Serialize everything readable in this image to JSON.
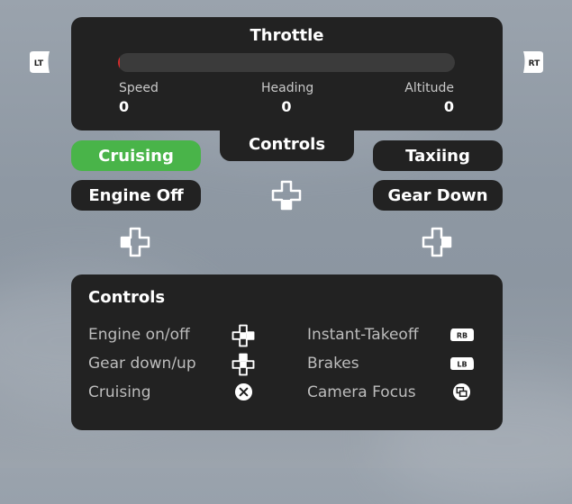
{
  "throttle": {
    "title": "Throttle",
    "level": 0.0,
    "stats": [
      {
        "label": "Speed",
        "value": "0"
      },
      {
        "label": "Heading",
        "value": "0"
      },
      {
        "label": "Altitude",
        "value": "0"
      }
    ]
  },
  "triggers": {
    "left": "LT",
    "right": "RT"
  },
  "modes": {
    "cruising": "Cruising",
    "engine": "Engine Off",
    "taxiing": "Taxiing",
    "gear": "Gear Down",
    "controls_tab": "Controls"
  },
  "colors": {
    "active": "#49b449",
    "panel": "#222222",
    "throttle_marker": "#d42a2a"
  },
  "help": {
    "title": "Controls",
    "left": [
      {
        "label": "Engine on/off",
        "icon": "dpad-right-icon"
      },
      {
        "label": "Gear down/up",
        "icon": "dpad-up-icon"
      },
      {
        "label": "Cruising",
        "icon": "x-button-icon"
      }
    ],
    "right": [
      {
        "label": "Instant-Takeoff",
        "icon": "rb-button-icon",
        "badge": "RB"
      },
      {
        "label": "Brakes",
        "icon": "lb-button-icon",
        "badge": "LB"
      },
      {
        "label": "Camera Focus",
        "icon": "view-button-icon"
      }
    ]
  }
}
